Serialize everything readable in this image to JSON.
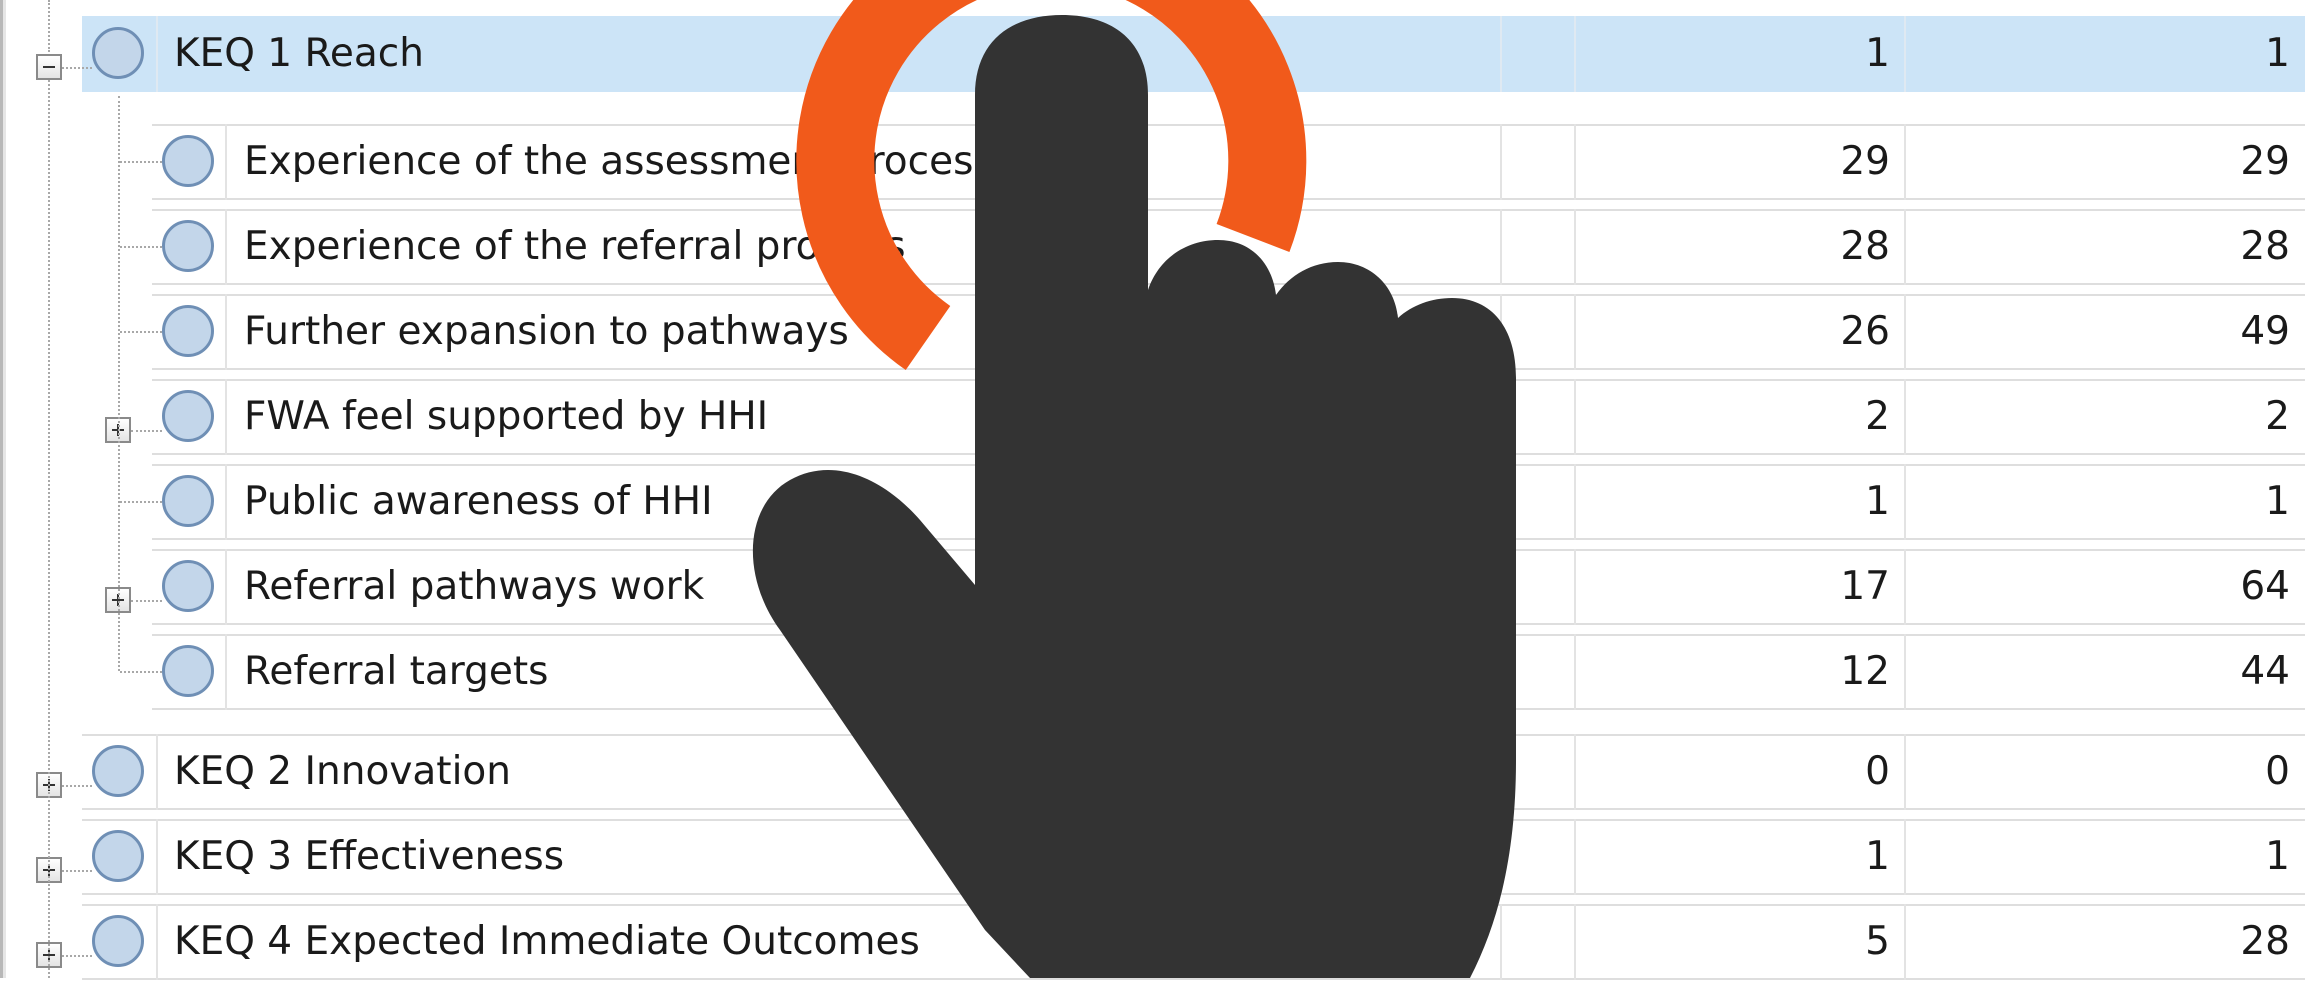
{
  "tree": {
    "rows": [
      {
        "name": "KEQ 1 Reach",
        "refs": "1",
        "codes": "1",
        "level": "top",
        "expander": "minus",
        "selected": true
      },
      {
        "name": "Experience of the assessment process",
        "refs": "29",
        "codes": "29",
        "level": "child",
        "expander": "none"
      },
      {
        "name": "Experience of the referral process",
        "refs": "28",
        "codes": "28",
        "level": "child",
        "expander": "none"
      },
      {
        "name": "Further expansion to pathways",
        "refs": "26",
        "codes": "49",
        "level": "child",
        "expander": "none"
      },
      {
        "name": "FWA feel supported by HHI",
        "refs": "2",
        "codes": "2",
        "level": "child",
        "expander": "plus"
      },
      {
        "name": "Public awareness of HHI",
        "refs": "1",
        "codes": "1",
        "level": "child",
        "expander": "none"
      },
      {
        "name": "Referral pathways work",
        "refs": "17",
        "codes": "64",
        "level": "child",
        "expander": "plus"
      },
      {
        "name": "Referral targets",
        "refs": "12",
        "codes": "44",
        "level": "child",
        "expander": "none"
      },
      {
        "name": "KEQ 2 Innovation",
        "refs": "0",
        "codes": "0",
        "level": "top",
        "expander": "plus"
      },
      {
        "name": "KEQ 3 Effectiveness",
        "refs": "1",
        "codes": "1",
        "level": "top",
        "expander": "plus"
      },
      {
        "name": "KEQ 4 Expected Immediate Outcomes",
        "refs": "5",
        "codes": "28",
        "level": "top",
        "expander": "plus"
      }
    ]
  },
  "overlay": {
    "hand_icon": "pointing-hand-icon",
    "ring_icon": "tap-ring-icon",
    "hand_color": "#333333",
    "ring_color": "#f15a1b"
  },
  "colors": {
    "selection": "#cce4f7",
    "node_fill": "#c3d6ea",
    "node_stroke": "#6f8fb5",
    "gridline": "#dedede"
  }
}
